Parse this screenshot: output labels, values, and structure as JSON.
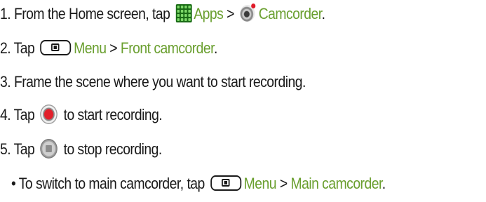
{
  "steps": [
    {
      "prefix": "1. From the Home screen, tap ",
      "apps": "Apps",
      "sep": " > ",
      "camcorder": "Camcorder",
      "suffix": "."
    },
    {
      "prefix": "2. Tap ",
      "menu": "Menu",
      "sep": " > ",
      "target": "Front camcorder",
      "suffix": "."
    },
    {
      "text": "3. Frame the scene where you want to start recording."
    },
    {
      "prefix": "4. Tap ",
      "suffix": " to start recording."
    },
    {
      "prefix": "5. Tap ",
      "suffix": " to stop recording."
    },
    {
      "bullet": "• ",
      "prefix": "To switch to main camcorder, tap ",
      "menu": "Menu",
      "sep": " > ",
      "target": "Main camcorder",
      "suffix": "."
    }
  ],
  "icons": {
    "apps": "apps-grid-icon",
    "camcorder": "camcorder-icon",
    "menu": "menu-key-icon",
    "record": "record-button-icon",
    "stop": "stop-button-icon"
  },
  "colors": {
    "link_green": "#6a9f2f",
    "text": "#1a1a1a",
    "record_red": "#e2202b"
  }
}
